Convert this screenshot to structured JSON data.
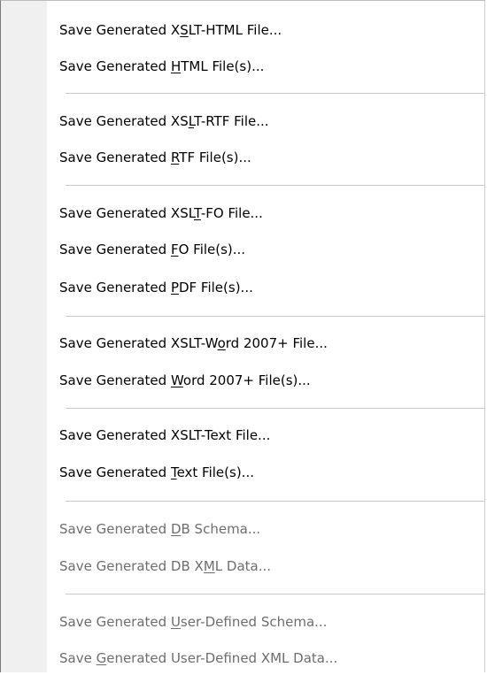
{
  "menu": {
    "items": [
      {
        "pre": "Save Generated X",
        "key": "S",
        "post": "LT-HTML File...",
        "enabled": true
      },
      {
        "pre": "Save Generated ",
        "key": "H",
        "post": "TML File(s)...",
        "enabled": true
      },
      {
        "pre": "Save Generated XS",
        "key": "L",
        "post": "T-RTF File...",
        "enabled": true
      },
      {
        "pre": "Save Generated ",
        "key": "R",
        "post": "TF File(s)...",
        "enabled": true
      },
      {
        "pre": "Save Generated XSL",
        "key": "T",
        "post": "-FO File...",
        "enabled": true
      },
      {
        "pre": "Save Generated ",
        "key": "F",
        "post": "O File(s)...",
        "enabled": true
      },
      {
        "pre": "Save Generated ",
        "key": "P",
        "post": "DF File(s)...",
        "enabled": true
      },
      {
        "pre": "Save Generated XSLT-W",
        "key": "o",
        "post": "rd 2007+ File...",
        "enabled": true
      },
      {
        "pre": "Save Generated ",
        "key": "W",
        "post": "ord 2007+ File(s)...",
        "enabled": true
      },
      {
        "pre": "Save Generated XSLT-Text File...",
        "key": "",
        "post": "",
        "enabled": true
      },
      {
        "pre": "Save Generated ",
        "key": "T",
        "post": "ext File(s)...",
        "enabled": true
      },
      {
        "pre": "Save Generated ",
        "key": "D",
        "post": "B Schema...",
        "enabled": false
      },
      {
        "pre": "Save Generated DB X",
        "key": "M",
        "post": "L Data...",
        "enabled": false
      },
      {
        "pre": "Save Generated ",
        "key": "U",
        "post": "ser-Defined Schema...",
        "enabled": false
      },
      {
        "pre": "Save ",
        "key": "G",
        "post": "enerated User-Defined XML Data...",
        "enabled": false
      }
    ]
  }
}
